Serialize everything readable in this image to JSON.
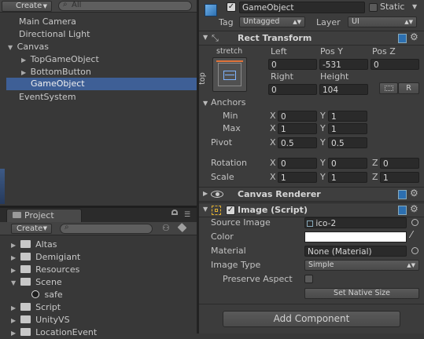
{
  "hierarchy": {
    "create_label": "Create",
    "search_placeholder": "All",
    "items": [
      {
        "label": "Main Camera"
      },
      {
        "label": "Directional Light"
      },
      {
        "label": "Canvas"
      },
      {
        "label": "TopGameObject"
      },
      {
        "label": "BottomButton"
      },
      {
        "label": "GameObject"
      },
      {
        "label": "EventSystem"
      }
    ]
  },
  "project": {
    "tab_label": "Project",
    "create_label": "Create",
    "folders": [
      {
        "label": "Altas"
      },
      {
        "label": "Demigiant"
      },
      {
        "label": "Resources"
      },
      {
        "label": "Scene"
      },
      {
        "label": "safe"
      },
      {
        "label": "Script"
      },
      {
        "label": "UnityVS"
      },
      {
        "label": "LocationEvent"
      }
    ]
  },
  "inspector": {
    "object_name": "GameObject",
    "static_label": "Static",
    "tag_label": "Tag",
    "tag_value": "Untagged",
    "layer_label": "Layer",
    "layer_value": "UI",
    "rect_transform": {
      "title": "Rect Transform",
      "anchor_h": "stretch",
      "anchor_v": "top",
      "left_label": "Left",
      "posy_label": "Pos Y",
      "posz_label": "Pos Z",
      "left": "0",
      "posy": "-531",
      "posz": "0",
      "right_label": "Right",
      "height_label": "Height",
      "right": "0",
      "height": "104",
      "r_button": "R",
      "anchors_label": "Anchors",
      "min_label": "Min",
      "max_label": "Max",
      "pivot_label": "Pivot",
      "rotation_label": "Rotation",
      "scale_label": "Scale",
      "x": "X",
      "y": "Y",
      "z": "Z",
      "min_x": "0",
      "min_y": "1",
      "max_x": "1",
      "max_y": "1",
      "pivot_x": "0.5",
      "pivot_y": "0.5",
      "rot_x": "0",
      "rot_y": "0",
      "rot_z": "0",
      "scale_x": "1",
      "scale_y": "1",
      "scale_z": "1"
    },
    "canvas_renderer": {
      "title": "Canvas Renderer"
    },
    "image": {
      "title": "Image (Script)",
      "source_image_label": "Source Image",
      "source_image": "ico-2",
      "color_label": "Color",
      "material_label": "Material",
      "material": "None (Material)",
      "image_type_label": "Image Type",
      "image_type": "Simple",
      "preserve_aspect_label": "Preserve Aspect",
      "set_native_size": "Set Native Size"
    },
    "add_component": "Add Component"
  },
  "colors": {
    "selection": "#3e5f96",
    "panel_bg": "#383838",
    "inspector_bg": "#3c3c3c",
    "field_bg": "#2a2a2a",
    "unity_blue": "#2c6fb0"
  }
}
